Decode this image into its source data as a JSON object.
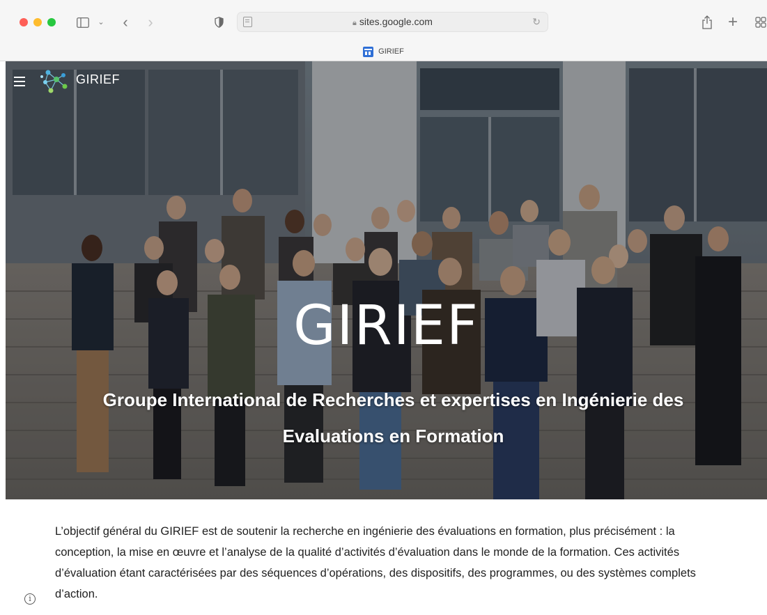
{
  "browser": {
    "address": "sites.google.com",
    "tab_title": "GIRIEF",
    "icons": [
      "sidebar-icon",
      "chevron-down-icon",
      "back-arrow-icon",
      "forward-arrow-icon",
      "shield-icon",
      "page-icon",
      "lock-icon",
      "reload-icon",
      "share-icon",
      "plus-icon",
      "tab-grid-icon"
    ],
    "window_colors": {
      "close": "#fe5f57",
      "minimize": "#febc2e",
      "maximize": "#28c840"
    }
  },
  "site": {
    "name": "GIRIEF",
    "hero_title": "GIRIEF",
    "hero_subtitle": "Groupe International de Recherches et expertises en Ingénierie des Evaluations en Formation",
    "intro": "L’objectif général du GIRIEF est de soutenir la recherche en ingénierie des évaluations en formation, plus précisément : la conception, la mise en œuvre et l’analyse de la qualité d’activités d’évaluation dans le monde de la formation. Ces activités d’évaluation étant caractérisées par des séquences d’opérations, des dispositifs, des programmes, ou des systèmes complets d’action."
  }
}
